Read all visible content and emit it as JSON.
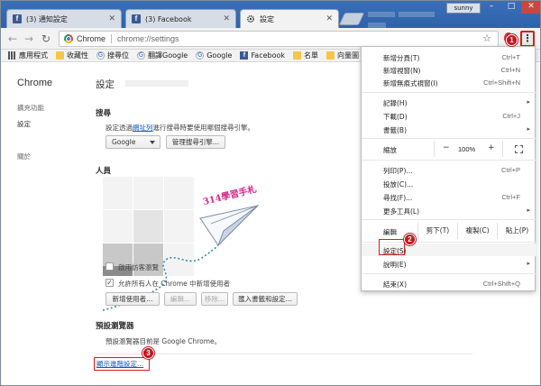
{
  "tabs": [
    {
      "label": "(3) 通知設定"
    },
    {
      "label": "(3) Facebook"
    },
    {
      "label": "設定"
    }
  ],
  "window": {
    "user": "sunny"
  },
  "toolbar": {
    "site": "Chrome",
    "url": "chrome://settings"
  },
  "bookmarks": [
    {
      "label": "應用程式",
      "icon": "apps-icon"
    },
    {
      "label": "收藏性",
      "icon": "folder-icon"
    },
    {
      "label": "搜尋位",
      "icon": "google-icon"
    },
    {
      "label": "翻譯Google",
      "icon": "google-icon"
    },
    {
      "label": "Google",
      "icon": "google-icon"
    },
    {
      "label": "Facebook",
      "icon": "facebook-icon"
    },
    {
      "label": "名單",
      "icon": "folder-icon"
    },
    {
      "label": "向量圖",
      "icon": "folder-icon"
    }
  ],
  "sidebar": {
    "title": "Chrome",
    "items": [
      {
        "label": "擴充功能"
      },
      {
        "label": "設定"
      },
      {
        "label": "關於"
      }
    ]
  },
  "main": {
    "title": "設定",
    "search": {
      "heading": "搜尋",
      "desc_before": "設定透過",
      "desc_link": "網址列",
      "desc_after": "進行搜尋時要使用哪個搜尋引擎。",
      "engine": "Google",
      "manage_button": "管理搜尋引擎..."
    },
    "people": {
      "heading": "人員",
      "logo_text": "314學習手札",
      "guest_label": "啟用訪客瀏覽",
      "allow_label": "允許所有人在 Chrome 中新增使用者",
      "add_button": "新增使用者...",
      "edit_button": "編輯...",
      "remove_button": "移除...",
      "import_button": "匯入書籤和設定..."
    },
    "default_browser": {
      "heading": "預設瀏覽器",
      "desc": "預設瀏覽器目前是 Google Chrome。"
    },
    "advanced_link": "顯示進階設定..."
  },
  "menu": {
    "items": [
      {
        "label": "新增分頁(T)",
        "shortcut": "Ctrl+T"
      },
      {
        "label": "新增視窗(N)",
        "shortcut": "Ctrl+N"
      },
      {
        "label": "新增無痕式視窗(I)",
        "shortcut": "Ctrl+Shift+N"
      },
      {
        "label": "記錄(H)"
      },
      {
        "label": "下載(D)",
        "shortcut": "Ctrl+J"
      },
      {
        "label": "書籤(B)"
      },
      {
        "label": "縮放"
      },
      {
        "label": "列印(P)...",
        "shortcut": "Ctrl+P"
      },
      {
        "label": "投放(C)..."
      },
      {
        "label": "尋找(F)...",
        "shortcut": "Ctrl+F"
      },
      {
        "label": "更多工具(L)"
      },
      {
        "label": "設定(S)"
      },
      {
        "label": "說明(E)"
      },
      {
        "label": "結束(X)",
        "shortcut": "Ctrl+Shift+Q"
      }
    ],
    "zoom": {
      "minus": "−",
      "value": "100%",
      "plus": "+"
    },
    "edit": {
      "label": "編輯",
      "cut": "剪下(T)",
      "copy": "複製(C)",
      "paste": "貼上(P)"
    }
  },
  "markers": {
    "one": "1",
    "two": "2",
    "three": "3"
  }
}
